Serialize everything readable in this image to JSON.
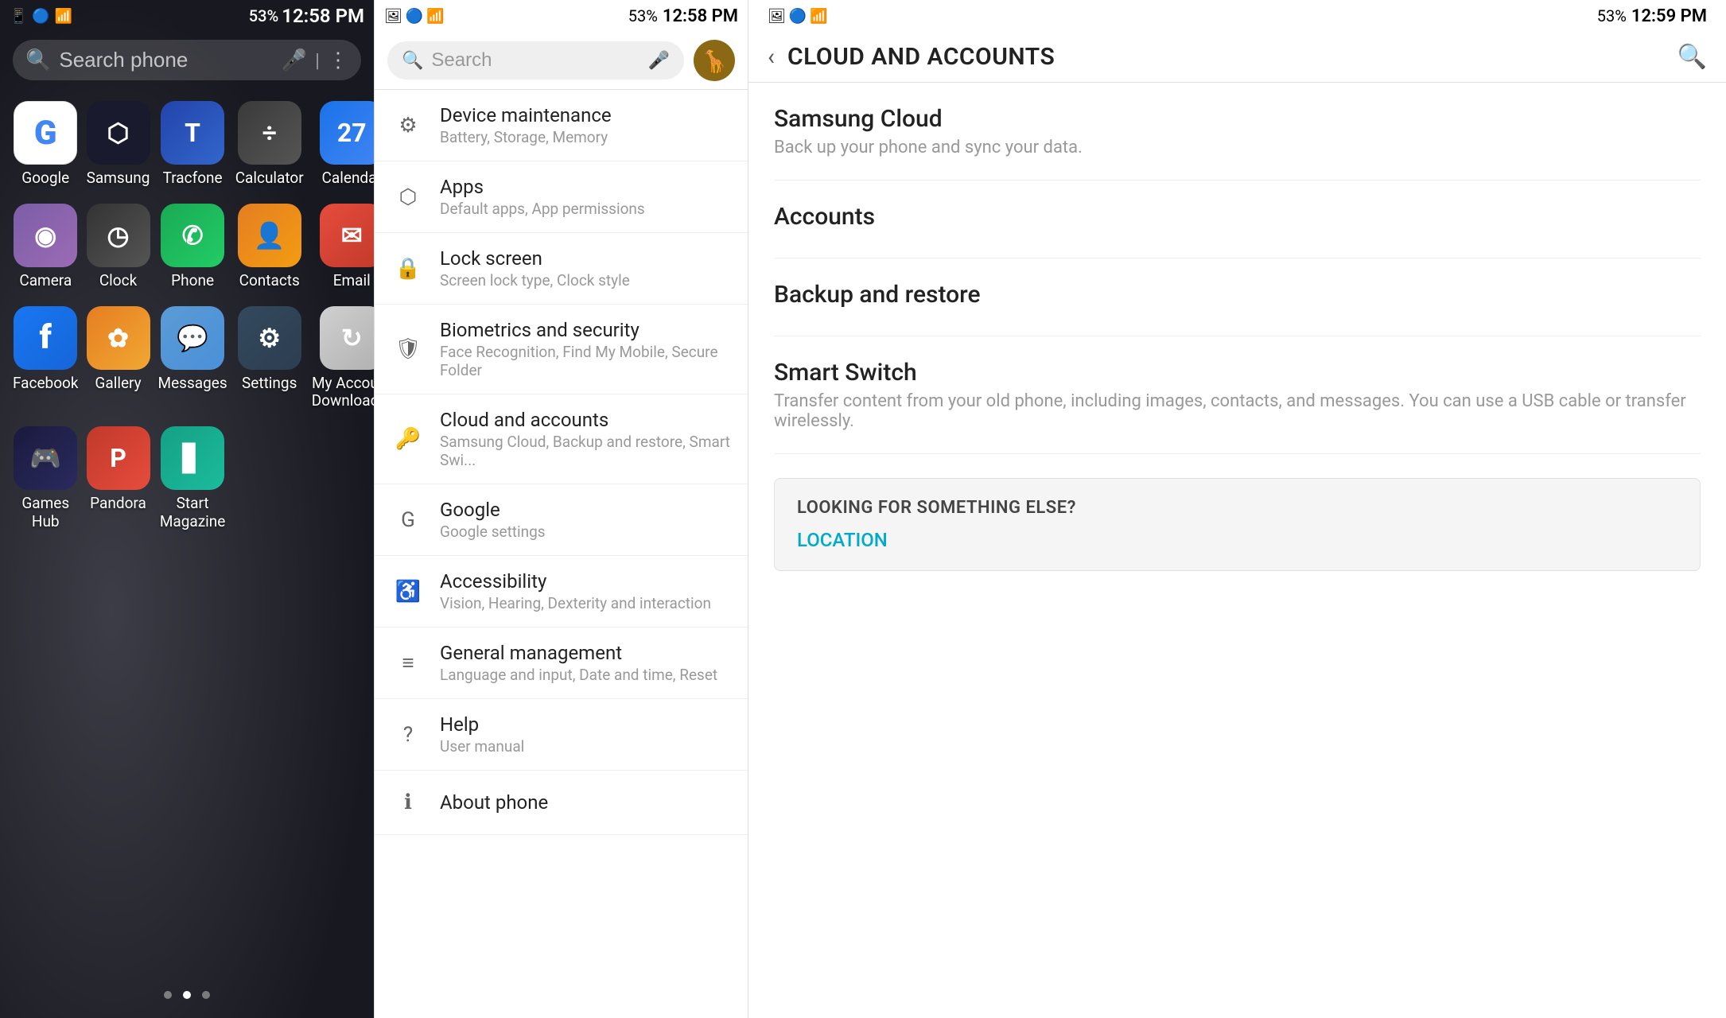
{
  "home": {
    "status_bar": {
      "time": "12:58 PM",
      "battery": "53%",
      "signal_icons": "📶"
    },
    "search_placeholder": "Search phone",
    "apps": [
      {
        "id": "google",
        "label": "Google",
        "icon": "G",
        "icon_class": "icon-google",
        "color": "#fff"
      },
      {
        "id": "samsung",
        "label": "Samsung",
        "icon": "⬡",
        "icon_class": "icon-samsung"
      },
      {
        "id": "tracfone",
        "label": "Tracfone",
        "icon": "T",
        "icon_class": "icon-tracfone"
      },
      {
        "id": "calculator",
        "label": "Calculator",
        "icon": "÷",
        "icon_class": "icon-calculator"
      },
      {
        "id": "calendar",
        "label": "Calendar",
        "icon": "27",
        "icon_class": "icon-calendar"
      },
      {
        "id": "camera",
        "label": "Camera",
        "icon": "◉",
        "icon_class": "icon-camera"
      },
      {
        "id": "clock",
        "label": "Clock",
        "icon": "◷",
        "icon_class": "icon-clock"
      },
      {
        "id": "phone",
        "label": "Phone",
        "icon": "✆",
        "icon_class": "icon-phone"
      },
      {
        "id": "contacts",
        "label": "Contacts",
        "icon": "👤",
        "icon_class": "icon-contacts"
      },
      {
        "id": "email",
        "label": "Email",
        "icon": "✉",
        "icon_class": "icon-email"
      },
      {
        "id": "facebook",
        "label": "Facebook",
        "icon": "f",
        "icon_class": "icon-facebook"
      },
      {
        "id": "gallery",
        "label": "Gallery",
        "icon": "✿",
        "icon_class": "icon-gallery"
      },
      {
        "id": "messages",
        "label": "Messages",
        "icon": "💬",
        "icon_class": "icon-messages"
      },
      {
        "id": "settings",
        "label": "Settings",
        "icon": "⚙",
        "icon_class": "icon-settings"
      },
      {
        "id": "myaccount",
        "label": "My Account Downloader",
        "icon": "↻",
        "icon_class": "icon-myaccount"
      },
      {
        "id": "gameshub",
        "label": "Games Hub",
        "icon": "🎮",
        "icon_class": "icon-gameshub"
      },
      {
        "id": "pandora",
        "label": "Pandora",
        "icon": "P",
        "icon_class": "icon-pandora"
      },
      {
        "id": "startmag",
        "label": "Start Magazine",
        "icon": "▋",
        "icon_class": "icon-startmag"
      }
    ],
    "dots": [
      false,
      true,
      false
    ]
  },
  "settings": {
    "status_bar": {
      "time": "12:58 PM",
      "battery": "53%"
    },
    "search_placeholder": "Search",
    "items": [
      {
        "id": "device-maintenance",
        "title": "Device maintenance",
        "subtitle": "Battery, Storage, Memory",
        "icon": "⚙"
      },
      {
        "id": "apps",
        "title": "Apps",
        "subtitle": "Default apps, App permissions",
        "icon": "⬡"
      },
      {
        "id": "lock-screen",
        "title": "Lock screen",
        "subtitle": "Screen lock type, Clock style",
        "icon": "🔒"
      },
      {
        "id": "biometrics",
        "title": "Biometrics and security",
        "subtitle": "Face Recognition, Find My Mobile, Secure Folder",
        "icon": "🛡"
      },
      {
        "id": "cloud-accounts",
        "title": "Cloud and accounts",
        "subtitle": "Samsung Cloud, Backup and restore, Smart Swi...",
        "icon": "🔑"
      },
      {
        "id": "google",
        "title": "Google",
        "subtitle": "Google settings",
        "icon": "G"
      },
      {
        "id": "accessibility",
        "title": "Accessibility",
        "subtitle": "Vision, Hearing, Dexterity and interaction",
        "icon": "♿"
      },
      {
        "id": "general-management",
        "title": "General management",
        "subtitle": "Language and input, Date and time, Reset",
        "icon": "≡"
      },
      {
        "id": "help",
        "title": "Help",
        "subtitle": "User manual",
        "icon": "?"
      },
      {
        "id": "about-phone",
        "title": "About phone",
        "subtitle": "",
        "icon": "ℹ"
      }
    ]
  },
  "cloud": {
    "status_bar": {
      "time": "12:59 PM",
      "battery": "53%"
    },
    "title": "CLOUD AND ACCOUNTS",
    "sections": [
      {
        "id": "samsung-cloud",
        "title": "Samsung Cloud",
        "subtitle": "Back up your phone and sync your data."
      },
      {
        "id": "accounts",
        "title": "Accounts",
        "subtitle": ""
      },
      {
        "id": "backup-restore",
        "title": "Backup and restore",
        "subtitle": ""
      },
      {
        "id": "smart-switch",
        "title": "Smart Switch",
        "subtitle": "Transfer content from your old phone, including images, contacts, and messages. You can use a USB cable or transfer wirelessly."
      }
    ],
    "looking_for": {
      "title": "LOOKING FOR SOMETHING ELSE?",
      "link_label": "LOCATION"
    }
  }
}
